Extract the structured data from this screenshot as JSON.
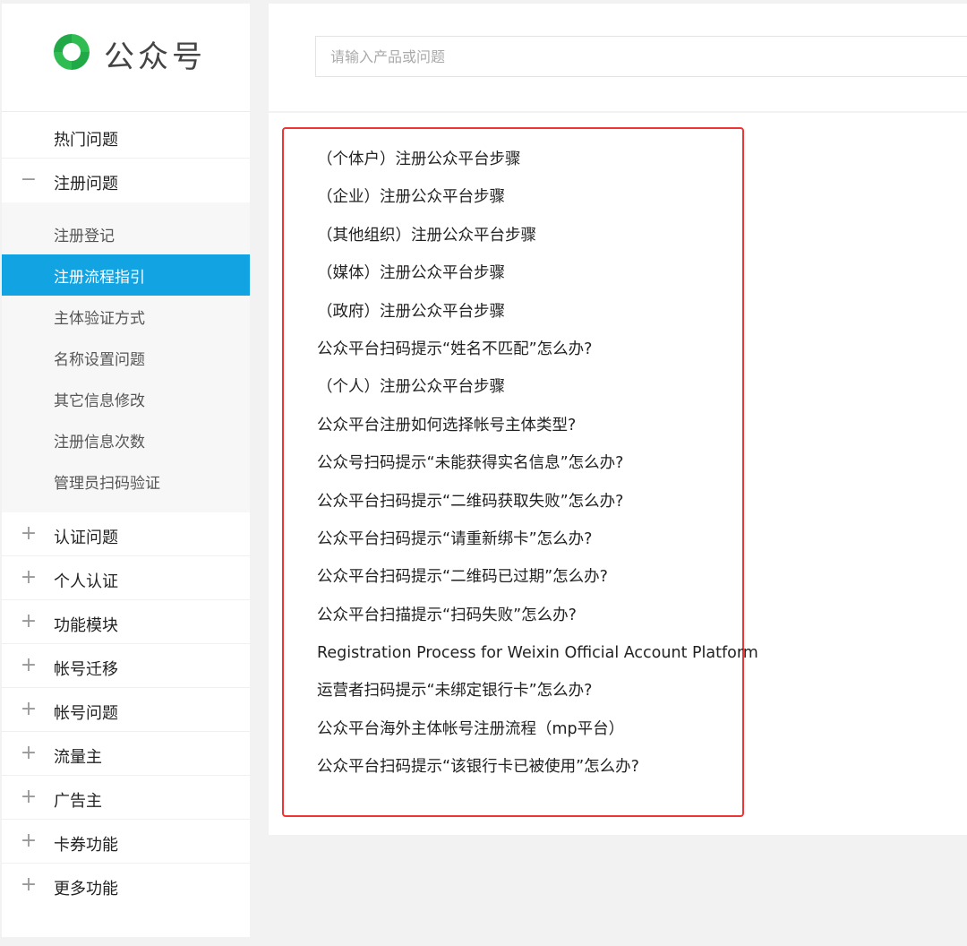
{
  "logo": {
    "text": "公众号"
  },
  "search": {
    "placeholder": "请输入产品或问题"
  },
  "sidebar": {
    "top_items": [
      {
        "label": "热门问题",
        "sign": ""
      },
      {
        "label": "注册问题",
        "sign": "−"
      }
    ],
    "sub_items": [
      {
        "label": "注册登记"
      },
      {
        "label": "注册流程指引"
      },
      {
        "label": "主体验证方式"
      },
      {
        "label": "名称设置问题"
      },
      {
        "label": "其它信息修改"
      },
      {
        "label": "注册信息次数"
      },
      {
        "label": "管理员扫码验证"
      }
    ],
    "active_sub": "注册流程指引",
    "bottom_items": [
      {
        "label": "认证问题",
        "sign": "+"
      },
      {
        "label": "个人认证",
        "sign": "+"
      },
      {
        "label": "功能模块",
        "sign": "+"
      },
      {
        "label": "帐号迁移",
        "sign": "+"
      },
      {
        "label": "帐号问题",
        "sign": "+"
      },
      {
        "label": "流量主",
        "sign": "+"
      },
      {
        "label": "广告主",
        "sign": "+"
      },
      {
        "label": "卡券功能",
        "sign": "+"
      },
      {
        "label": "更多功能",
        "sign": "+"
      }
    ]
  },
  "questions": [
    "（个体户）注册公众平台步骤",
    "（企业）注册公众平台步骤",
    "（其他组织）注册公众平台步骤",
    "（媒体）注册公众平台步骤",
    "（政府）注册公众平台步骤",
    "公众平台扫码提示“姓名不匹配”怎么办?",
    "（个人）注册公众平台步骤",
    "公众平台注册如何选择帐号主体类型?",
    "公众号扫码提示“未能获得实名信息”怎么办?",
    "公众平台扫码提示“二维码获取失败”怎么办?",
    "公众平台扫码提示“请重新绑卡”怎么办?",
    "公众平台扫码提示“二维码已过期”怎么办?",
    "公众平台扫描提示“扫码失败”怎么办?",
    "Registration Process for Weixin Official Account Platform",
    "运营者扫码提示“未绑定银行卡”怎么办?",
    "公众平台海外主体帐号注册流程（mp平台）",
    "公众平台扫码提示“该银行卡已被使用”怎么办?"
  ],
  "colors": {
    "active_bg": "#11a3e2",
    "highlight_border": "#ee3434",
    "logo_green": "#2fbd51"
  }
}
